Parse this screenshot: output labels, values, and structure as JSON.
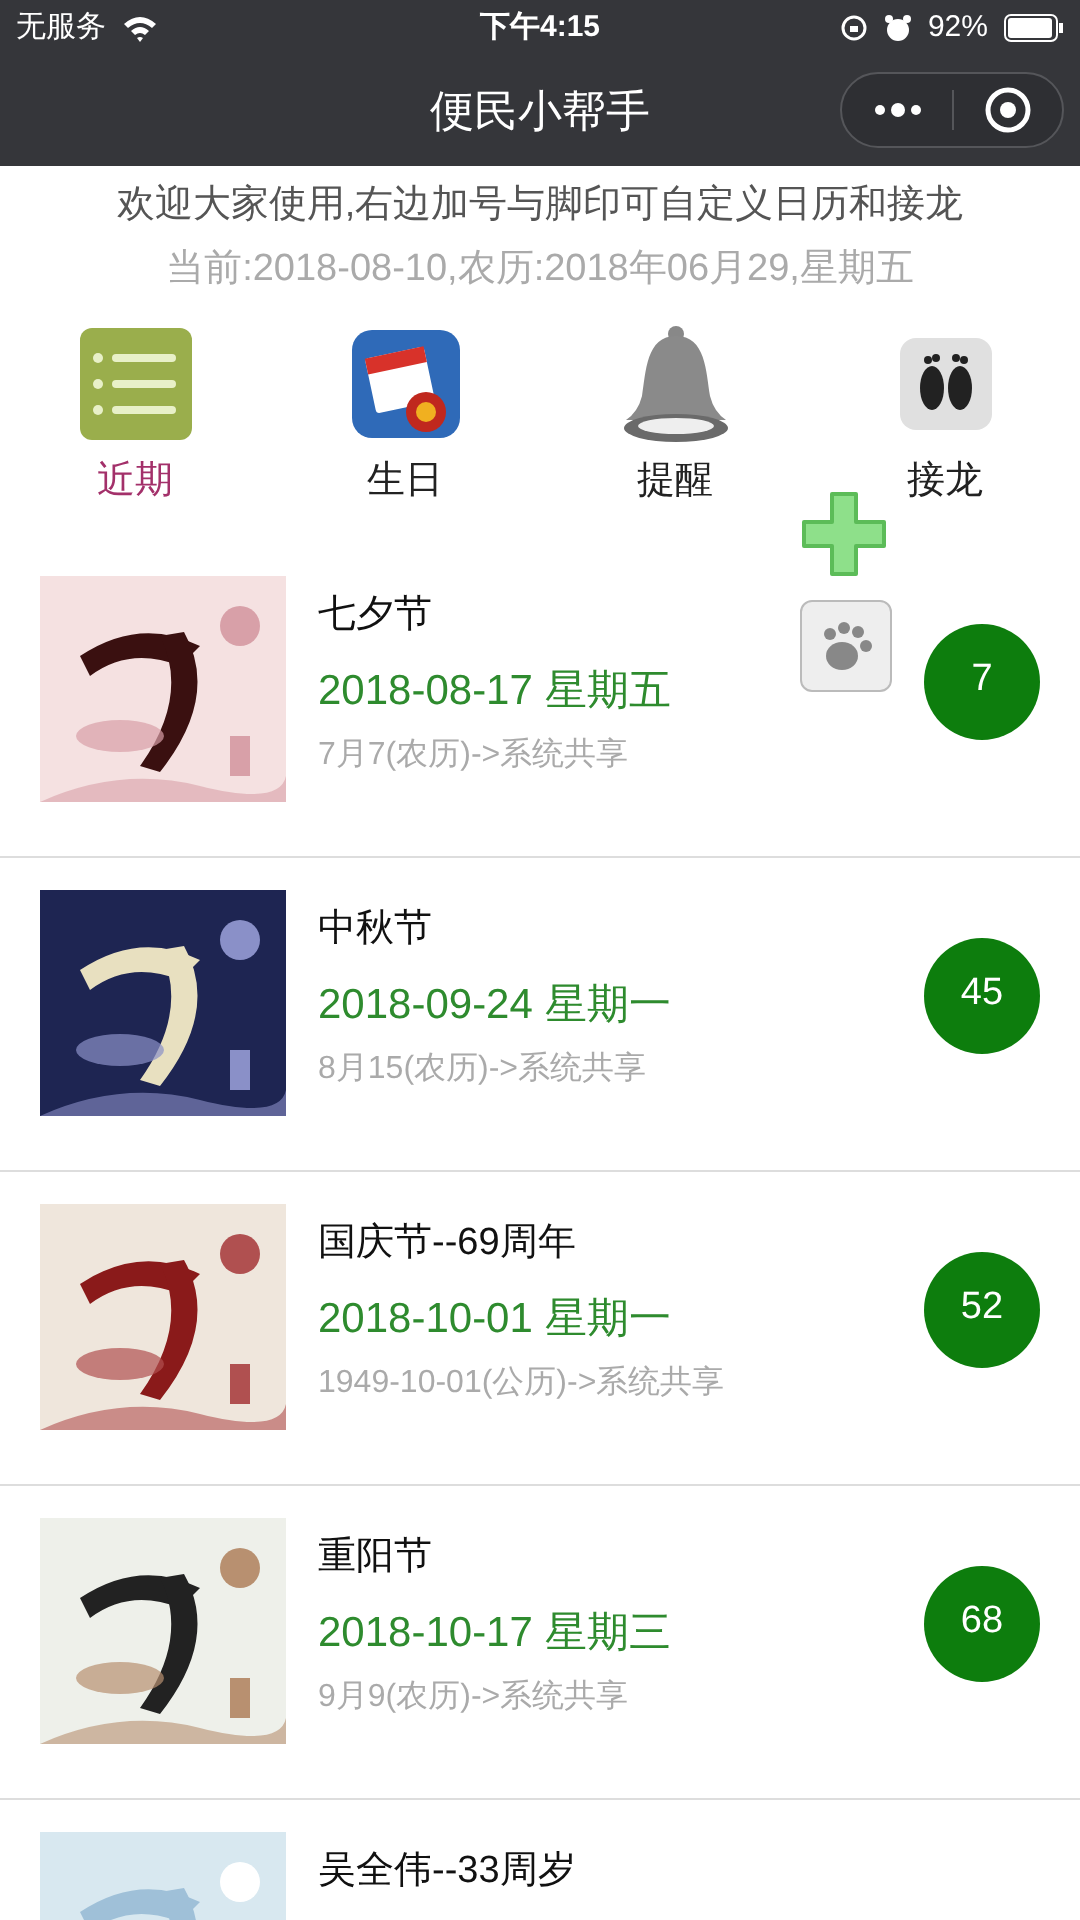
{
  "status_bar": {
    "carrier": "无服务",
    "time": "下午4:15",
    "battery": "92%"
  },
  "nav_bar": {
    "title": "便民小帮手"
  },
  "intro": {
    "line1": "欢迎大家使用,右边加号与脚印可自定义日历和接龙",
    "line2": "当前:2018-08-10,农历:2018年06月29,星期五"
  },
  "tabs": [
    {
      "label": "近期",
      "selected": true
    },
    {
      "label": "生日",
      "selected": false
    },
    {
      "label": "提醒",
      "selected": false
    },
    {
      "label": "接龙",
      "selected": false
    }
  ],
  "events": [
    {
      "title": "七夕节",
      "date": "2018-08-17 星期五",
      "source": "7月7(农历)->系统共享",
      "days": "7"
    },
    {
      "title": "中秋节",
      "date": "2018-09-24 星期一",
      "source": "8月15(农历)->系统共享",
      "days": "45"
    },
    {
      "title": "国庆节--69周年",
      "date": "2018-10-01 星期一",
      "source": "1949-10-01(公历)->系统共享",
      "days": "52"
    },
    {
      "title": "重阳节",
      "date": "2018-10-17 星期三",
      "source": "9月9(农历)->系统共享",
      "days": "68"
    },
    {
      "title": "吴全伟--33周岁"
    }
  ]
}
